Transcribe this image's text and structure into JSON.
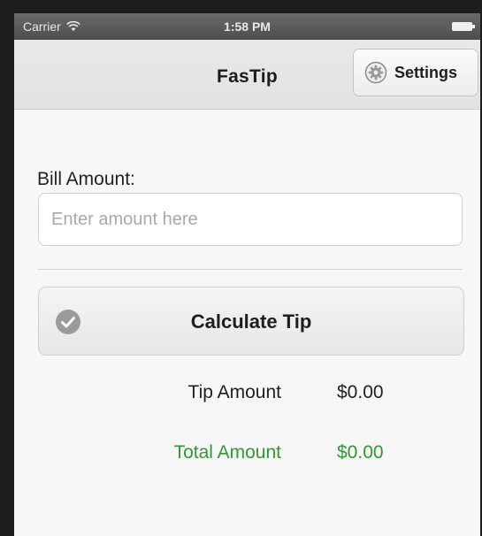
{
  "status_bar": {
    "carrier": "Carrier",
    "time": "1:58 PM",
    "wifi_icon": "wifi-icon",
    "battery_icon": "battery-icon"
  },
  "nav_bar": {
    "title": "FasTip",
    "settings_button": {
      "label": "Settings",
      "icon": "gear-icon"
    }
  },
  "form": {
    "bill_label": "Bill Amount:",
    "amount_input": {
      "value": "",
      "placeholder": "Enter amount here"
    },
    "calculate_button": {
      "label": "Calculate Tip",
      "icon": "check-icon"
    }
  },
  "results": {
    "tip": {
      "label": "Tip Amount",
      "value": "$0.00"
    },
    "total": {
      "label": "Total Amount",
      "value": "$0.00"
    }
  },
  "colors": {
    "accent_green": "#2f9a2f",
    "status_bar": "#5a5a5a",
    "nav_bar": "#e6e6e6",
    "background": "#f7f7f7"
  }
}
